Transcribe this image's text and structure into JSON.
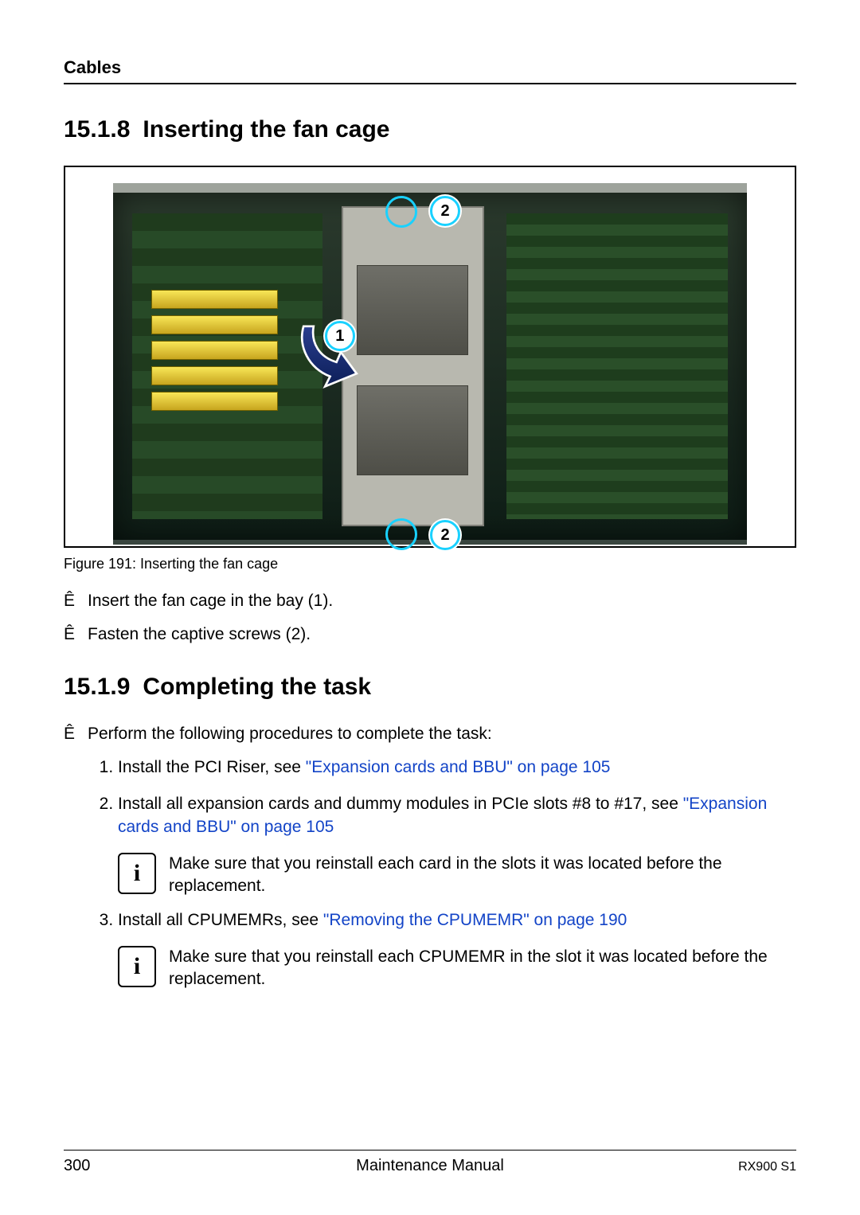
{
  "header": {
    "chapter": "Cables"
  },
  "section1": {
    "number": "15.1.8",
    "title": "Inserting the fan cage",
    "figure_caption": "Figure 191: Inserting the fan cage",
    "markers": {
      "top": "2",
      "bottom": "2",
      "arrow": "1"
    },
    "steps": [
      "Insert the fan cage in the bay (1).",
      "Fasten the captive screws (2)."
    ]
  },
  "section2": {
    "number": "15.1.9",
    "title": "Completing the task",
    "lead_step": "Perform the following procedures to complete the task:",
    "items": [
      {
        "text_before": "Install the PCI Riser, see ",
        "link": "\"Expansion cards and BBU\" on page 105",
        "text_after": ""
      },
      {
        "text_before": "Install all expansion cards and dummy modules in PCIe slots #8 to #17, see ",
        "link": "\"Expansion cards and BBU\" on page 105",
        "text_after": "",
        "info": "Make sure that you reinstall each card in the slots it was located before the replacement."
      },
      {
        "text_before": "Install all CPUMEMRs, see ",
        "link": "\"Removing the CPUMEMR\" on page 190",
        "text_after": "",
        "info": "Make sure that you reinstall each CPUMEMR in the slot it was located before the replacement."
      }
    ]
  },
  "footer": {
    "page": "300",
    "center": "Maintenance Manual",
    "model": "RX900 S1"
  },
  "glyph": {
    "step": "Ê",
    "info": "i"
  }
}
